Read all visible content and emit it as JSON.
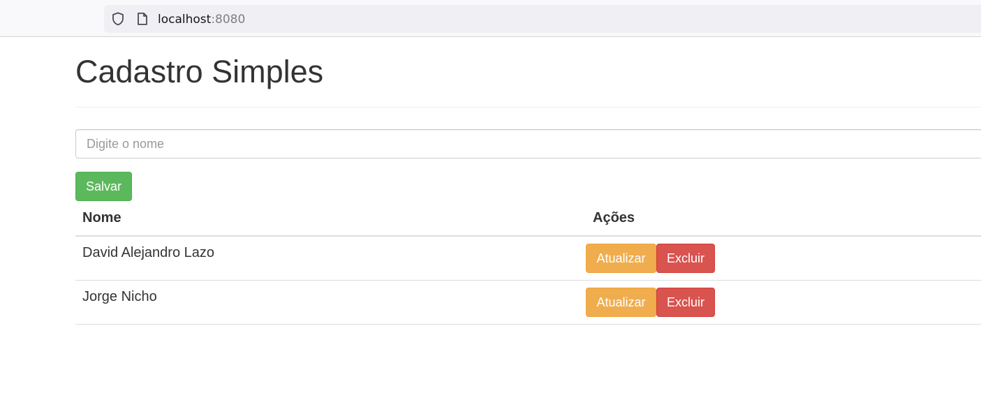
{
  "browser": {
    "url_host": "localhost",
    "url_port": ":8080"
  },
  "page": {
    "title": "Cadastro Simples",
    "name_placeholder": "Digite o nome",
    "name_value": "",
    "save_label": "Salvar"
  },
  "table": {
    "headers": [
      "Nome",
      "Ações"
    ],
    "rows": [
      {
        "name": "David Alejandro Lazo",
        "update_label": "Atualizar",
        "delete_label": "Excluir"
      },
      {
        "name": "Jorge Nicho",
        "update_label": "Atualizar",
        "delete_label": "Excluir"
      }
    ]
  },
  "icons": {
    "tracking_protection": "shield-icon",
    "page_info": "page-icon"
  },
  "colors": {
    "save": "#5cb85c",
    "update": "#f0ad4e",
    "delete": "#d9534f"
  }
}
